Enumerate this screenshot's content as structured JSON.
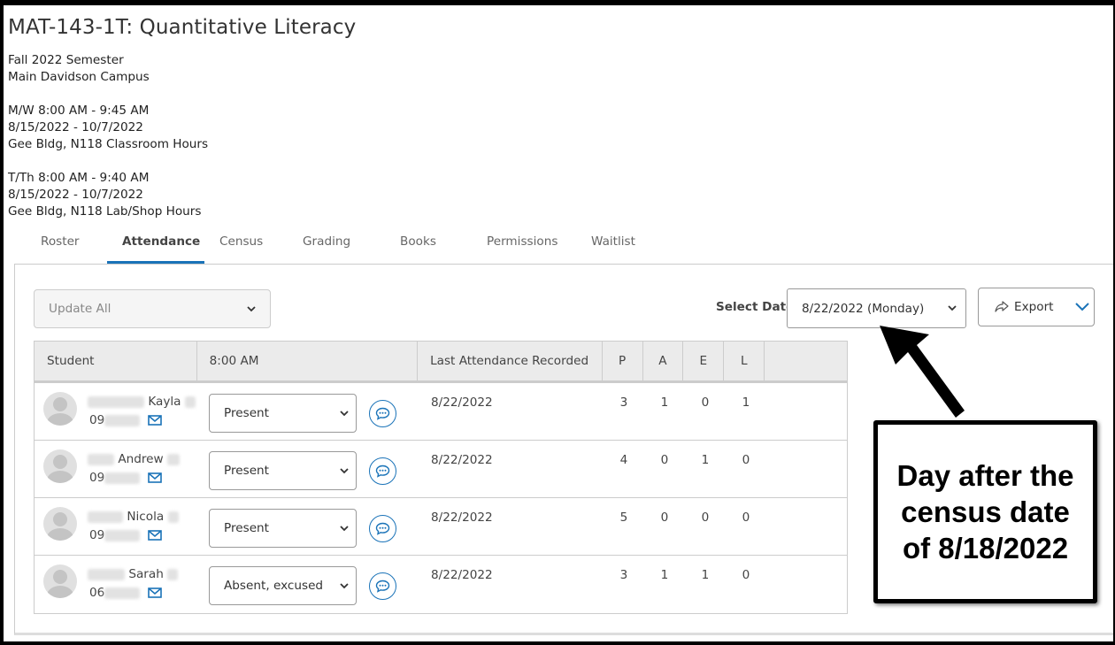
{
  "course": {
    "title": "MAT-143-1T: Quantitative Literacy",
    "semester": "Fall 2022 Semester",
    "campus": "Main Davidson Campus",
    "schedules": [
      {
        "days_time": "M/W 8:00 AM - 9:45 AM",
        "dates": "8/15/2022 - 10/7/2022",
        "location": "Gee Bldg, N118 Classroom Hours"
      },
      {
        "days_time": "T/Th 8:00 AM - 9:40 AM",
        "dates": "8/15/2022 - 10/7/2022",
        "location": "Gee Bldg, N118 Lab/Shop Hours"
      }
    ]
  },
  "tabs": [
    "Roster",
    "Attendance",
    "Census",
    "Grading",
    "Books",
    "Permissions",
    "Waitlist"
  ],
  "active_tab": "Attendance",
  "toolbar": {
    "update_all": "Update All",
    "select_date_label": "Select Date",
    "selected_date": "8/22/2022 (Monday)",
    "export_label": "Export"
  },
  "table": {
    "headers": {
      "student": "Student",
      "time": "8:00 AM",
      "last": "Last Attendance Recorded",
      "p": "P",
      "a": "A",
      "e": "E",
      "l": "L"
    },
    "rows": [
      {
        "first_name": "Kayla",
        "id_prefix": "09",
        "status": "Present",
        "last": "8/22/2022",
        "p": "3",
        "a": "1",
        "e": "0",
        "l": "1"
      },
      {
        "first_name": "Andrew",
        "id_prefix": "09",
        "status": "Present",
        "last": "8/22/2022",
        "p": "4",
        "a": "0",
        "e": "1",
        "l": "0"
      },
      {
        "first_name": "Nicola",
        "id_prefix": "09",
        "status": "Present",
        "last": "8/22/2022",
        "p": "5",
        "a": "0",
        "e": "0",
        "l": "0"
      },
      {
        "first_name": "Sarah",
        "id_prefix": "06",
        "status": "Absent, excused",
        "last": "8/22/2022",
        "p": "3",
        "a": "1",
        "e": "1",
        "l": "0"
      }
    ]
  },
  "callout": {
    "lines": [
      "Day after the",
      "census date",
      "of 8/18/2022"
    ]
  },
  "colors": {
    "accent": "#1a73b8"
  }
}
